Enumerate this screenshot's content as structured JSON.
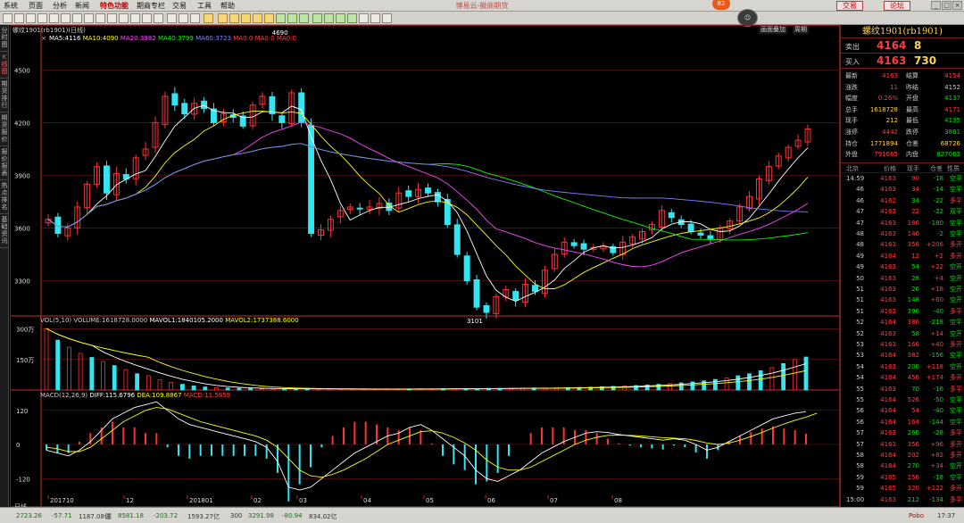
{
  "menu": {
    "items": [
      "系统",
      "页面",
      "分析",
      "新闻",
      "特色功能",
      "期商专栏",
      "交易",
      "工具",
      "帮助"
    ],
    "active_index": 4,
    "app_title": "博易云-徽商期货",
    "trade_label": "交易",
    "forum_label": "论坛",
    "badge_count": "82"
  },
  "toolbar": {
    "zoom_in_label": "画面叠加",
    "zoom_out_label": "周期"
  },
  "left_tabs": [
    "分时图",
    "K线图",
    "期货排行",
    "期货报价",
    "报价报表",
    "热点排名",
    "基础资讯"
  ],
  "left_tabs_selected": 1,
  "chart": {
    "header": "螺纹1901(rb1901)(日线)",
    "close_glyph": "×",
    "ma_legend": [
      {
        "text": "MA5:4116",
        "color": "#ffffff"
      },
      {
        "text": "MA10:4090",
        "color": "#ffff00"
      },
      {
        "text": "MA20:3982",
        "color": "#ff44ff"
      },
      {
        "text": "MA40:3799",
        "color": "#00ff00"
      },
      {
        "text": "MA60:3723",
        "color": "#8080ff"
      },
      {
        "text": "MA0:0",
        "color": "#ff4444"
      },
      {
        "text": "MA0:0",
        "color": "#ff4444"
      },
      {
        "text": "MA0:0",
        "color": "#ff4444"
      }
    ],
    "vol_legend": [
      {
        "text": "VOL(5,10)",
        "color": "#cccccc"
      },
      {
        "text": "VOLUME:1618728.0000",
        "color": "#cccccc"
      },
      {
        "text": "MAVOL1:1840105.2000",
        "color": "#ffffff"
      },
      {
        "text": "MAVOL2:1737388.6000",
        "color": "#ffff00"
      }
    ],
    "macd_legend": [
      {
        "text": "MACD(12,26,9)",
        "color": "#cccccc"
      },
      {
        "text": "DIFF:115.6796",
        "color": "#ffffff"
      },
      {
        "text": "DEA:109.8867",
        "color": "#ffff00"
      },
      {
        "text": "MACD:11.5859",
        "color": "#ff4444"
      }
    ],
    "period_label": "日线",
    "colors": {
      "up": "#ff3232",
      "down": "#33e5f0",
      "grid": "#7f1a1a",
      "axis": "#cc2a2a"
    }
  },
  "chart_data": {
    "type": "candlestick",
    "title": "螺纹1901(rb1901)(日线)",
    "price_ylim": [
      3100,
      4700
    ],
    "price_ticks": [
      3300,
      3600,
      3900,
      4200,
      4500
    ],
    "price_annotations": [
      {
        "label": "4690",
        "value": 4690
      },
      {
        "label": "3101",
        "value": 3101
      }
    ],
    "close": [
      3650,
      3570,
      3600,
      3720,
      3850,
      3950,
      3800,
      3910,
      3880,
      4000,
      4050,
      4200,
      4350,
      4300,
      4250,
      4310,
      4280,
      4200,
      4250,
      4230,
      4180,
      4300,
      4350,
      4250,
      4200,
      4370,
      4200,
      3570,
      3590,
      3650,
      3700,
      3720,
      3710,
      3720,
      3740,
      3700,
      3800,
      3780,
      3820,
      3800,
      3750,
      3620,
      3450,
      3300,
      3150,
      3120,
      3210,
      3250,
      3190,
      3280,
      3240,
      3360,
      3450,
      3520,
      3500,
      3480,
      3490,
      3500,
      3460,
      3520,
      3550,
      3580,
      3620,
      3700,
      3660,
      3620,
      3580,
      3560,
      3540,
      3600,
      3640,
      3720,
      3780,
      3880,
      3950,
      4010,
      4060,
      4100,
      4164
    ],
    "volume_wan": [
      302,
      245,
      210,
      180,
      160,
      140,
      120,
      100,
      80,
      70,
      50,
      38,
      28,
      20,
      15,
      12,
      10,
      8,
      8,
      6,
      6,
      6,
      6,
      6,
      5,
      5,
      5,
      5,
      5,
      5,
      5,
      5,
      5,
      6,
      6,
      6,
      7,
      7,
      7,
      8,
      8,
      9,
      9,
      10,
      10,
      11,
      12,
      13,
      14,
      16,
      18,
      20,
      22,
      25,
      28,
      31,
      35,
      40,
      45,
      52,
      60,
      70,
      80,
      95,
      110,
      130,
      150,
      162
    ],
    "volume_ticks": [
      "150万",
      "300万"
    ],
    "macd_ticks": [
      120,
      0,
      -120
    ],
    "macd_ylim": [
      -160,
      160
    ],
    "macd": {
      "diff": [
        -20,
        -30,
        -40,
        -20,
        10,
        50,
        90,
        110,
        130,
        140,
        150,
        120,
        90,
        70,
        60,
        50,
        40,
        30,
        20,
        10,
        -10,
        -60,
        -150,
        -160,
        -150,
        -120,
        -90,
        -60,
        -30,
        -10,
        10,
        30,
        40,
        60,
        70,
        50,
        20,
        -10,
        -40,
        -90,
        -120,
        -130,
        -110,
        -90,
        -60,
        -30,
        -10,
        10,
        25,
        40,
        45,
        42,
        35,
        30,
        25,
        20,
        15,
        20,
        15,
        0,
        -20,
        -10,
        10,
        30,
        50,
        70,
        90,
        100,
        110,
        115
      ],
      "dea": [
        -10,
        -15,
        -25,
        -25,
        -10,
        20,
        50,
        80,
        100,
        120,
        130,
        125,
        110,
        95,
        80,
        70,
        60,
        50,
        40,
        30,
        15,
        -10,
        -50,
        -90,
        -110,
        -115,
        -105,
        -90,
        -70,
        -50,
        -25,
        0,
        15,
        30,
        45,
        48,
        40,
        25,
        5,
        -20,
        -55,
        -80,
        -90,
        -90,
        -80,
        -60,
        -40,
        -20,
        0,
        15,
        25,
        32,
        33,
        32,
        30,
        27,
        24,
        22,
        20,
        14,
        5,
        0,
        5,
        15,
        28,
        42,
        58,
        72,
        85,
        96,
        110
      ]
    },
    "x_ticks": [
      "201710",
      "12",
      "201801",
      "02",
      "03",
      "04",
      "05",
      "06",
      "07",
      "08"
    ]
  },
  "quote": {
    "title": "螺纹1901(rb1901)",
    "ask_label": "卖出",
    "ask_price": "4164",
    "ask_qty": "8",
    "bid_label": "买入",
    "bid_price": "4163",
    "bid_qty": "730",
    "rows": [
      {
        "k": "最新",
        "v": "4163",
        "vc": "#ff3d3d",
        "k2": "结算",
        "v2": "4154",
        "v2c": "#ff3d3d"
      },
      {
        "k": "涨跌",
        "v": "11",
        "vc": "#ff3d3d",
        "k2": "昨结",
        "v2": "4152",
        "v2c": "#cccccc"
      },
      {
        "k": "幅度",
        "v": "0.26%",
        "vc": "#ff3d3d",
        "k2": "开盘",
        "v2": "4137",
        "v2c": "#00e000"
      },
      {
        "k": "总手",
        "v": "1618728",
        "vc": "#ffd34d",
        "k2": "最高",
        "v2": "4171",
        "v2c": "#ff3d3d"
      },
      {
        "k": "现手",
        "v": "212",
        "vc": "#ffd34d",
        "k2": "最低",
        "v2": "4135",
        "v2c": "#00e000"
      },
      {
        "k": "涨停",
        "v": "4442",
        "vc": "#ff3d3d",
        "k2": "跌停",
        "v2": "3861",
        "v2c": "#00e000"
      },
      {
        "k": "持仓",
        "v": "1771894",
        "vc": "#ffd34d",
        "k2": "仓差",
        "v2": "68726",
        "v2c": "#ffd34d"
      },
      {
        "k": "外盘",
        "v": "791665",
        "vc": "#ff3d3d",
        "k2": "内盘",
        "v2": "827063",
        "v2c": "#00e000"
      }
    ]
  },
  "ticks": {
    "headers": {
      "time": "北京",
      "price": "价格",
      "qty": "现手",
      "oi": "仓差",
      "nature": "性质"
    },
    "rows": [
      {
        "t": "14:59",
        "p": "4163",
        "q": "90",
        "o": "-18",
        "n": "空平",
        "nc": "#00e000",
        "qc": "#ff3d3d"
      },
      {
        "t": "46",
        "p": "4163",
        "q": "34",
        "o": "-14",
        "n": "空平",
        "nc": "#00e000",
        "qc": "#ff3d3d"
      },
      {
        "t": "46",
        "p": "4162",
        "q": "34",
        "o": "-22",
        "n": "多平",
        "nc": "#ff3d3d",
        "qc": "#00e000"
      },
      {
        "t": "47",
        "p": "4163",
        "q": "22",
        "o": "-22",
        "n": "双平",
        "nc": "#00e000",
        "qc": "#ff3d3d"
      },
      {
        "t": "47",
        "p": "4163",
        "q": "186",
        "o": "-180",
        "n": "空平",
        "nc": "#00e000",
        "qc": "#ff3d3d"
      },
      {
        "t": "48",
        "p": "4163",
        "q": "146",
        "o": "-2",
        "n": "空平",
        "nc": "#00e000",
        "qc": "#ff3d3d"
      },
      {
        "t": "48",
        "p": "4163",
        "q": "358",
        "o": "+206",
        "n": "多开",
        "nc": "#ff3d3d",
        "qc": "#ff3d3d"
      },
      {
        "t": "49",
        "p": "4164",
        "q": "12",
        "o": "+2",
        "n": "多开",
        "nc": "#ff3d3d",
        "qc": "#ff3d3d"
      },
      {
        "t": "49",
        "p": "4163",
        "q": "54",
        "o": "+22",
        "n": "空开",
        "nc": "#00e000",
        "qc": "#00e000"
      },
      {
        "t": "50",
        "p": "4163",
        "q": "28",
        "o": "+4",
        "n": "空开",
        "nc": "#00e000",
        "qc": "#00e000"
      },
      {
        "t": "51",
        "p": "4163",
        "q": "26",
        "o": "+18",
        "n": "空开",
        "nc": "#00e000",
        "qc": "#00e000"
      },
      {
        "t": "51",
        "p": "4163",
        "q": "148",
        "o": "+60",
        "n": "空开",
        "nc": "#00e000",
        "qc": "#00e000"
      },
      {
        "t": "51",
        "p": "4163",
        "q": "396",
        "o": "-40",
        "n": "多平",
        "nc": "#ff3d3d",
        "qc": "#00e000"
      },
      {
        "t": "52",
        "p": "4164",
        "q": "386",
        "o": "-218",
        "n": "空平",
        "nc": "#00e000",
        "qc": "#ff3d3d"
      },
      {
        "t": "52",
        "p": "4163",
        "q": "58",
        "o": "+14",
        "n": "空开",
        "nc": "#00e000",
        "qc": "#00e000"
      },
      {
        "t": "53",
        "p": "4163",
        "q": "166",
        "o": "+40",
        "n": "多开",
        "nc": "#ff3d3d",
        "qc": "#ff3d3d"
      },
      {
        "t": "53",
        "p": "4164",
        "q": "382",
        "o": "-156",
        "n": "空平",
        "nc": "#00e000",
        "qc": "#ff3d3d"
      },
      {
        "t": "54",
        "p": "4163",
        "q": "206",
        "o": "+118",
        "n": "空开",
        "nc": "#00e000",
        "qc": "#00e000"
      },
      {
        "t": "54",
        "p": "4164",
        "q": "456",
        "o": "+174",
        "n": "多开",
        "nc": "#ff3d3d",
        "qc": "#ff3d3d"
      },
      {
        "t": "55",
        "p": "4163",
        "q": "70",
        "o": "-16",
        "n": "多平",
        "nc": "#ff3d3d",
        "qc": "#00e000"
      },
      {
        "t": "55",
        "p": "4164",
        "q": "526",
        "o": "-50",
        "n": "空平",
        "nc": "#00e000",
        "qc": "#ff3d3d"
      },
      {
        "t": "56",
        "p": "4164",
        "q": "54",
        "o": "-40",
        "n": "空平",
        "nc": "#00e000",
        "qc": "#ff3d3d"
      },
      {
        "t": "56",
        "p": "4164",
        "q": "164",
        "o": "-144",
        "n": "空平",
        "nc": "#00e000",
        "qc": "#ff3d3d"
      },
      {
        "t": "57",
        "p": "4163",
        "q": "266",
        "o": "-28",
        "n": "多平",
        "nc": "#ff3d3d",
        "qc": "#00e000"
      },
      {
        "t": "57",
        "p": "4163",
        "q": "356",
        "o": "+96",
        "n": "多开",
        "nc": "#ff3d3d",
        "qc": "#ff3d3d"
      },
      {
        "t": "58",
        "p": "4164",
        "q": "202",
        "o": "+82",
        "n": "多开",
        "nc": "#ff3d3d",
        "qc": "#ff3d3d"
      },
      {
        "t": "58",
        "p": "4164",
        "q": "270",
        "o": "+34",
        "n": "空开",
        "nc": "#00e000",
        "qc": "#00e000"
      },
      {
        "t": "59",
        "p": "4165",
        "q": "156",
        "o": "-18",
        "n": "空平",
        "nc": "#00e000",
        "qc": "#ff3d3d"
      },
      {
        "t": "59",
        "p": "4165",
        "q": "320",
        "o": "+122",
        "n": "多开",
        "nc": "#ff3d3d",
        "qc": "#ff3d3d"
      },
      {
        "t": "15:00",
        "p": "4163",
        "q": "212",
        "o": "-134",
        "n": "多平",
        "nc": "#ff3d3d",
        "qc": "#00e000"
      }
    ]
  },
  "status": [
    {
      "text": "2723.26",
      "color": "#0a7a0a"
    },
    {
      "text": "-57.71",
      "color": "#0a7a0a"
    },
    {
      "text": "1187.08亿",
      "color": "#333333"
    },
    {
      "text": "深",
      "color": "#333333"
    },
    {
      "text": "8581.18",
      "color": "#0a7a0a"
    },
    {
      "text": "-203.72",
      "color": "#0a7a0a"
    },
    {
      "text": "1593.27亿",
      "color": "#333333"
    },
    {
      "text": "300",
      "color": "#333333"
    },
    {
      "text": "3291.98",
      "color": "#0a7a0a"
    },
    {
      "text": "-80.94",
      "color": "#0a7a0a"
    },
    {
      "text": "834.02亿",
      "color": "#333333"
    },
    {
      "text": "Pobo",
      "color": "#c00000"
    },
    {
      "text": "17:37",
      "color": "#333333"
    }
  ]
}
